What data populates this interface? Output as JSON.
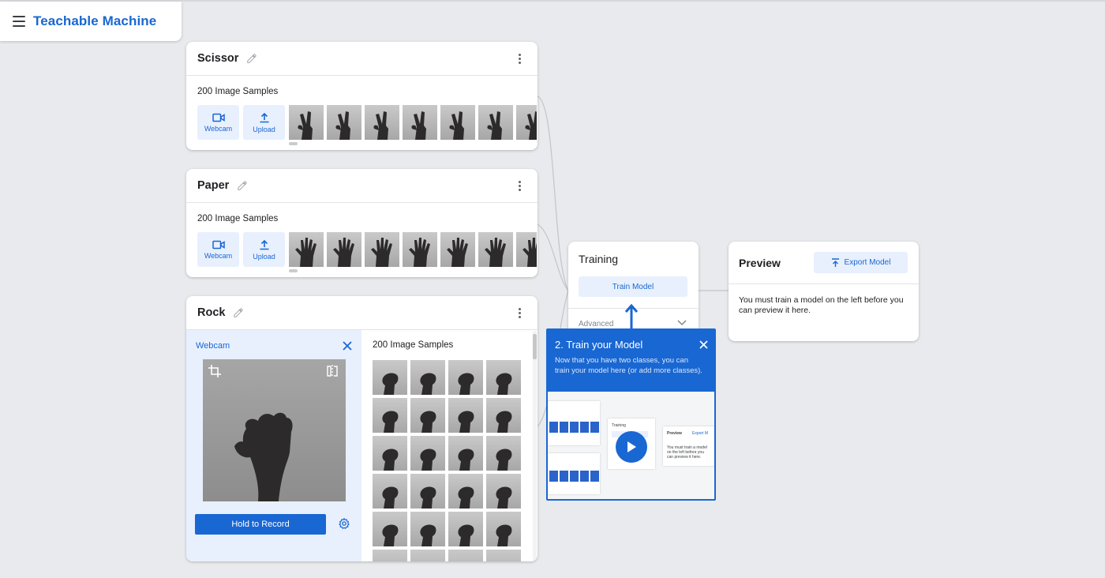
{
  "app": {
    "title": "Teachable Machine"
  },
  "classes": [
    {
      "name": "Scissor",
      "samples": "200 Image Samples",
      "webcam_label": "Webcam",
      "upload_label": "Upload",
      "gesture": "scissor"
    },
    {
      "name": "Paper",
      "samples": "200 Image Samples",
      "webcam_label": "Webcam",
      "upload_label": "Upload",
      "gesture": "paper"
    },
    {
      "name": "Rock",
      "samples": "200 Image Samples",
      "gesture": "rock"
    }
  ],
  "rock_webcam": {
    "label": "Webcam",
    "record_label": "Hold to Record"
  },
  "training": {
    "title": "Training",
    "train_label": "Train Model",
    "advanced_label": "Advanced"
  },
  "preview": {
    "title": "Preview",
    "export_label": "Export Model",
    "message": "You must train a model on the left before you can preview it here."
  },
  "tooltip": {
    "title": "2. Train your Model",
    "body": "Now that you have two classes, you can train your model here (or add more classes).",
    "mini_training": "Training",
    "mini_preview": "Preview",
    "mini_export": "Export M",
    "mini_message": "You must train a model on the left before you can preview it here."
  },
  "icons": {
    "menu": "menu-icon",
    "edit": "pencil-icon",
    "more": "kebab-icon",
    "webcam": "videocam-icon",
    "upload": "upload-icon",
    "close": "close-icon",
    "crop": "crop-icon",
    "flip": "flip-icon",
    "settings": "gear-icon",
    "expand": "chevron-down-icon",
    "export": "upload-icon",
    "play": "play-icon"
  },
  "colors": {
    "accent": "#1967d2",
    "accent_light": "#e8f0fe",
    "background": "#e8eaed"
  }
}
